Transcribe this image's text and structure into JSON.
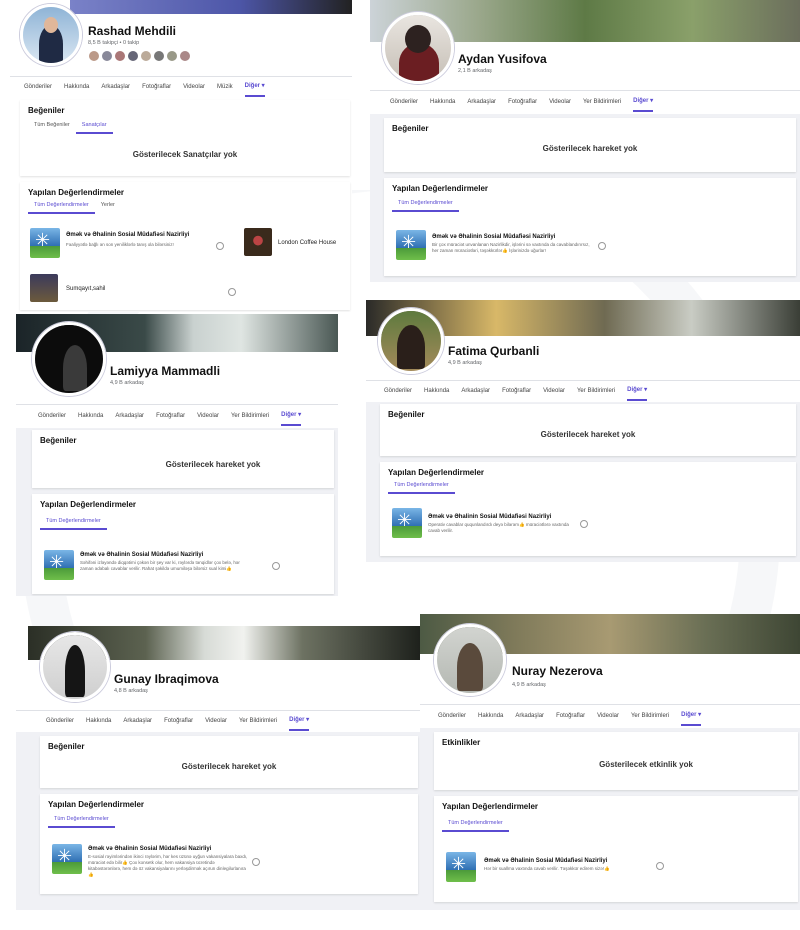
{
  "watermark": {
    "text": "yeniavaz.com"
  },
  "profiles": [
    {
      "name": "Rashad Mehdili",
      "stats": "8,5 B takipçi • 0 takip",
      "tabs": [
        "Gönderiler",
        "Hakkında",
        "Arkadaşlar",
        "Fotoğraflar",
        "Videolar",
        "Müzik",
        "Diğer ▾"
      ],
      "likes_title": "Beğeniler",
      "likes_subtabs": [
        "Tüm Beğeniler",
        "Sanatçılar"
      ],
      "likes_empty": "Gösterilecek Sanatçılar yok",
      "reviews_title": "Yapılan Değerlendirmeler",
      "reviews_subtabs": [
        "Tüm Değerlendirmeler",
        "Yerler"
      ],
      "reviews": [
        {
          "org": "Əmək və Əhalinin Sosial Müdafiəsi Nazirliyi",
          "text": "Fəaliyyətlə bağlı ən son yeniliklərlə tanış ola bilərsiniz!"
        },
        {
          "org": "London Coffee House",
          "text": ""
        },
        {
          "org": "Sumqayıt,sahil",
          "text": ""
        }
      ]
    },
    {
      "name": "Aydan Yusifova",
      "stats": "2,1 B arkadaş",
      "tabs": [
        "Gönderiler",
        "Hakkında",
        "Arkadaşlar",
        "Fotoğraflar",
        "Videolar",
        "Yer Bildirimleri",
        "Diğer ▾"
      ],
      "likes_title": "Beğeniler",
      "likes_empty": "Gösterilecek hareket yok",
      "reviews_title": "Yapılan Değerlendirmeler",
      "reviews_subtabs": [
        "Tüm Değerlendirmeler"
      ],
      "reviews": [
        {
          "org": "Əmək və Əhalinin Sosial Müdafiəsi Nazirliyi",
          "text": "Bir çox müraciət unvanlanan Nazirlikdir, işlərini sə vaxtında da cavablandırırsız, her zaman müraciətləri, təşəkkürlər👍 İşlərinizdə uğurlar!"
        }
      ]
    },
    {
      "name": "Lamiyya Mammadli",
      "stats": "4,9 B arkadaş",
      "tabs": [
        "Gönderiler",
        "Hakkında",
        "Arkadaşlar",
        "Fotoğraflar",
        "Videolar",
        "Yer Bildirimleri",
        "Diğer ▾"
      ],
      "likes_title": "Beğeniler",
      "likes_empty": "Gösterilecek hareket yok",
      "reviews_title": "Yapılan Değerlendirmeler",
      "reviews_subtabs": [
        "Tüm Değerlendirmeler"
      ],
      "reviews": [
        {
          "org": "Əmək və Əhalinin Sosial Müdafiəsi Nazirliyi",
          "text": "Səhifəni izləyəndə diqqətimi çəkən bir şey var ki, rəylərdə tənqidlər çox belə, hər zaman ədəbalı cavablar verilir. Rahat şəkildə umumiləşə bilərsiz sual kimi👍"
        }
      ]
    },
    {
      "name": "Fatima Qurbanli",
      "stats": "4,9 B arkadaş",
      "tabs": [
        "Gönderiler",
        "Hakkında",
        "Arkadaşlar",
        "Fotoğraflar",
        "Videolar",
        "Yer Bildirimleri",
        "Diğer ▾"
      ],
      "likes_title": "Beğeniler",
      "likes_empty": "Gösterilecek hareket yok",
      "reviews_title": "Yapılan Değerlendirmeler",
      "reviews_subtabs": [
        "Tüm Değerlendirmeler"
      ],
      "reviews": [
        {
          "org": "Əmək və Əhalinin Sosial Müdafiəsi Nazirliyi",
          "text": "Operativ cavablar ququnlandırdı deyə bilərəm👍 müraciətlərə vaxtında cavab verilir."
        }
      ]
    },
    {
      "name": "Gunay Ibraqimova",
      "stats": "4,8 B arkadaş",
      "tabs": [
        "Gönderiler",
        "Hakkında",
        "Arkadaşlar",
        "Fotoğraflar",
        "Videolar",
        "Yer Bildirimleri",
        "Diğer ▾"
      ],
      "likes_title": "Beğeniler",
      "likes_empty": "Gösterilecek hareket yok",
      "reviews_title": "Yapılan Değerlendirmeler",
      "reviews_subtabs": [
        "Tüm Değerlendirmeler"
      ],
      "reviews": [
        {
          "org": "Əmək və Əhalinin Sosial Müdafiəsi Nazirliyi",
          "text": "E-sosial rəyimlərindən ikinci rəylərim, hər kes üzünə uyğun vakansiyalara baxdı, müraciət edə bilir👍 Çox konsetk olur, hem vakansiya ücretində kitabəstərənlərə, hem də öz vakansiyalarını yerləşdirmək açırun dinlegilurlanıra👍"
        }
      ]
    },
    {
      "name": "Nuray Nezerova",
      "stats": "4,9 B arkadaş",
      "tabs": [
        "Gönderiler",
        "Hakkında",
        "Arkadaşlar",
        "Fotoğraflar",
        "Videolar",
        "Yer Bildirimleri",
        "Diğer ▾"
      ],
      "likes_title": "Etkinlikler",
      "likes_empty": "Gösterilecek etkinlik yok",
      "reviews_title": "Yapılan Değerlendirmeler",
      "reviews_subtabs": [
        "Tüm Değerlendirmeler"
      ],
      "reviews": [
        {
          "org": "Əmək və Əhalinin Sosial Müdafiəsi Nazirliyi",
          "text": "Hər bir suallma vaxtında cavab verilir. Təşəkkür edirem sizə!👍"
        }
      ]
    }
  ]
}
